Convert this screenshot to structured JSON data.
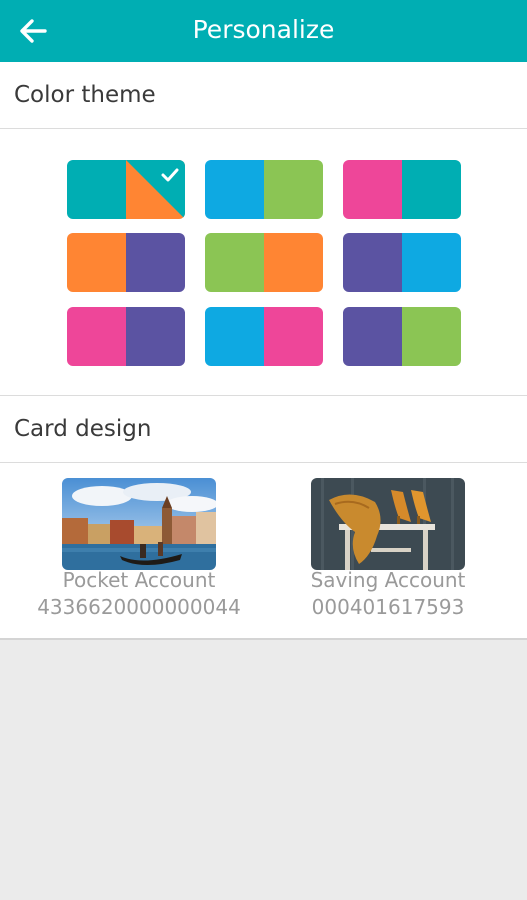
{
  "header": {
    "title": "Personalize",
    "back_icon": "arrow-left-icon",
    "background": "#00aeb3"
  },
  "color_theme": {
    "label": "Color theme",
    "selected_index": 0,
    "selected_icon": "check-icon",
    "themes": [
      {
        "left": "#00aeb3",
        "right": "#ff8533"
      },
      {
        "left": "#0ea9e2",
        "right": "#8bc554"
      },
      {
        "left": "#ee4699",
        "right": "#00aeb3"
      },
      {
        "left": "#ff8533",
        "right": "#5b53a2"
      },
      {
        "left": "#8bc554",
        "right": "#ff8533"
      },
      {
        "left": "#5b53a2",
        "right": "#0ea9e2"
      },
      {
        "left": "#ee4699",
        "right": "#5b53a2"
      },
      {
        "left": "#0ea9e2",
        "right": "#ee4699"
      },
      {
        "left": "#5b53a2",
        "right": "#8bc554"
      }
    ]
  },
  "card_design": {
    "label": "Card design",
    "cards": [
      {
        "name": "Pocket Account",
        "number": "4336620000000044",
        "image": "venice-canal-gondola-photo"
      },
      {
        "name": "Saving Account",
        "number": "000401617593",
        "image": "shoes-and-scarf-on-stool-photo"
      }
    ]
  }
}
